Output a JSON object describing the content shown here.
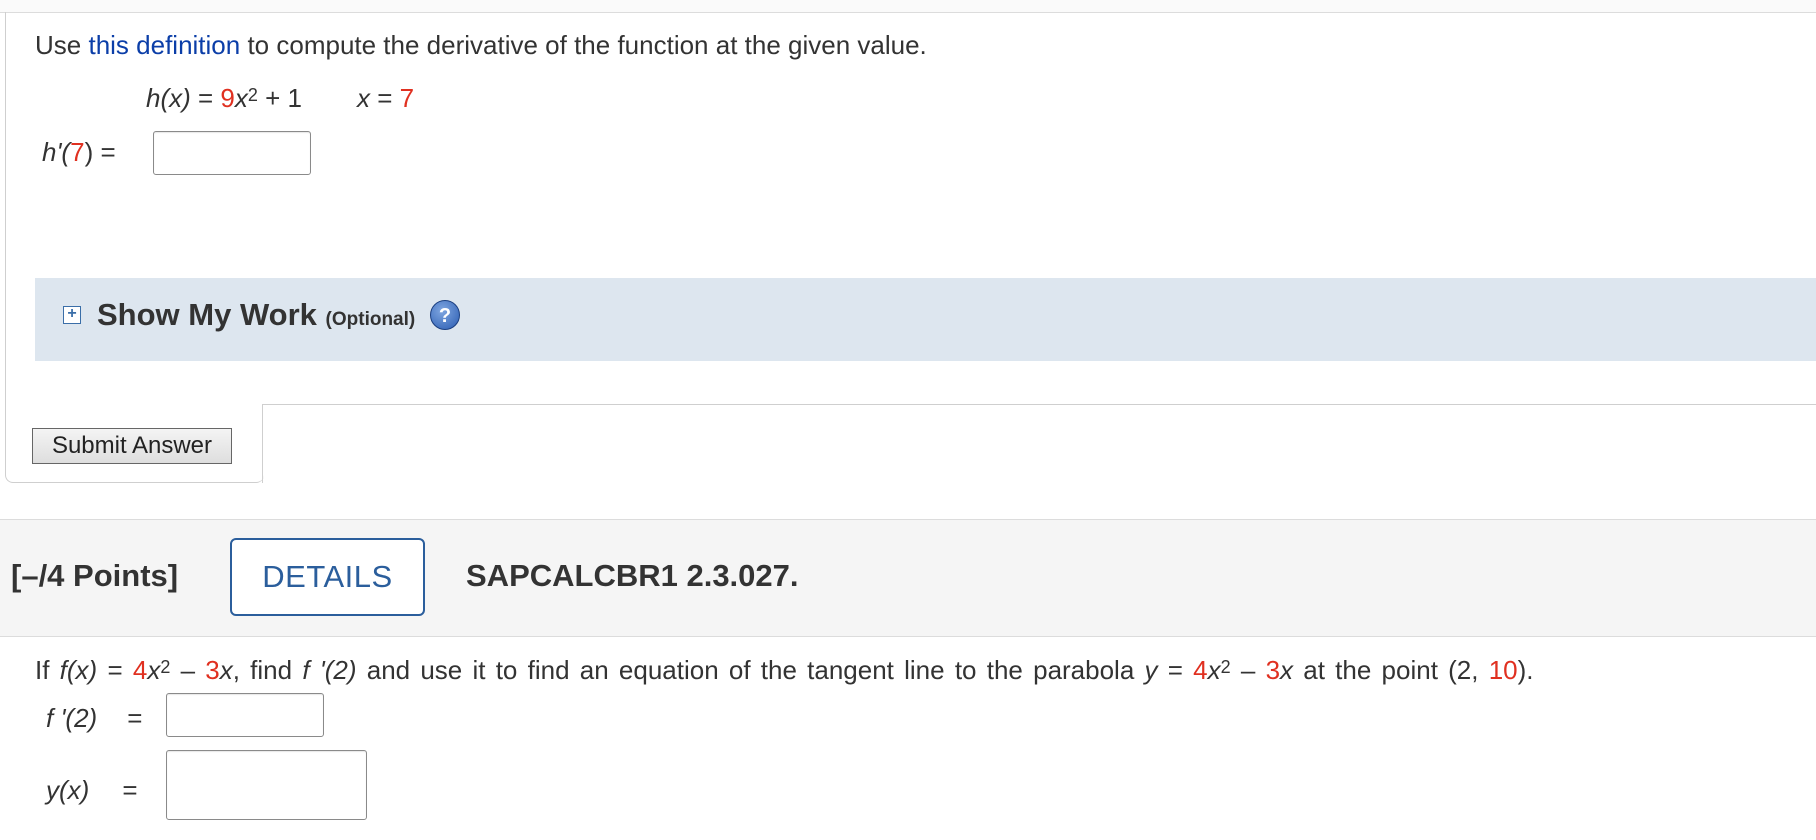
{
  "question1": {
    "prompt_before": "Use ",
    "prompt_link": "this definition",
    "prompt_after": " to compute the derivative of the function at the given value.",
    "function_lhs": "h(x)",
    "equals": " = ",
    "coef": "9",
    "var": "x",
    "exponent": "2",
    "plus_const": " + 1",
    "x_label": "x",
    "x_equals": " = ",
    "x_value": "7",
    "answer_func": "h'(",
    "answer_arg": "7",
    "answer_close": ") =",
    "answer_value": ""
  },
  "show_my_work": {
    "plus": "+",
    "title": "Show My Work",
    "optional": "(Optional)",
    "help": "?"
  },
  "submit_label": "Submit Answer",
  "question2": {
    "points": "[–/4 Points]",
    "details_label": "DETAILS",
    "question_id": "SAPCALCBR1 2.3.027.",
    "t_if": "If ",
    "t_fx": "f(x)",
    "t_eq": " = ",
    "t_c1": "4",
    "t_x1": "x",
    "t_e1": "2",
    "t_minus": " – ",
    "t_c2": "3",
    "t_x2": "x",
    "t_find": ", find ",
    "t_fp2": "f '(2)",
    "t_mid": " and use it to find an equation of the tangent line to the parabola ",
    "t_y": "y",
    "t_eq2": " = ",
    "t_c3": "4",
    "t_x3": "x",
    "t_e2": "2",
    "t_minus2": " – ",
    "t_c4": "3",
    "t_x4": "x",
    "t_point_pre": " at the point (2, ",
    "t_point_val": "10",
    "t_point_post": ").",
    "fprime_label": "f '(2)",
    "y_label": "y(x)",
    "eq_sign": "=",
    "fprime_value": "",
    "y_value": ""
  }
}
